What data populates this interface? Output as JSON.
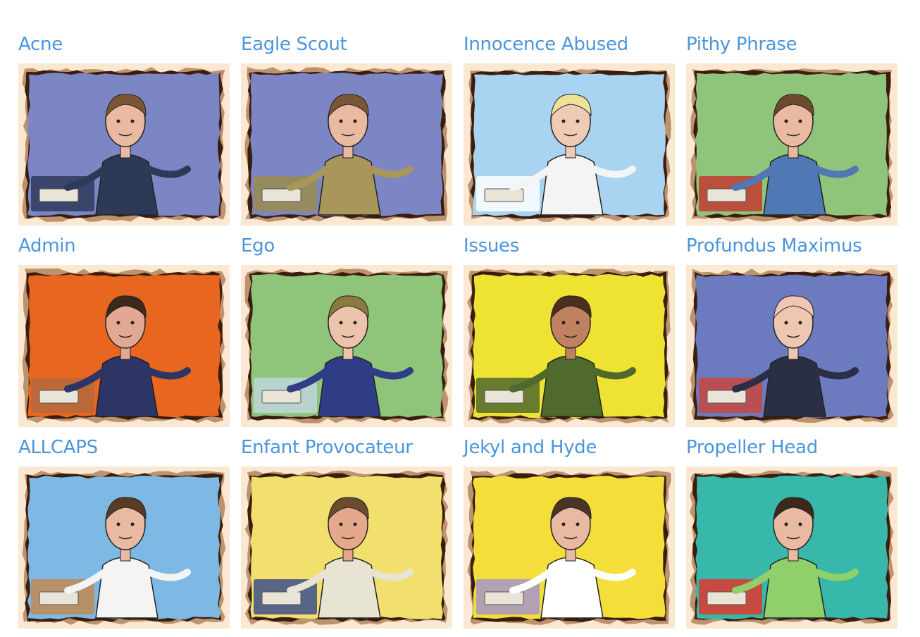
{
  "cards": [
    {
      "title": "Acne",
      "bg": "#7d86c5",
      "accent": "#2f3a5c",
      "shirt": "#2c3a57",
      "skin": "#e9b9a1",
      "hair": "#7a5635"
    },
    {
      "title": "Eagle Scout",
      "bg": "#7d86c5",
      "accent": "#9a8b4e",
      "shirt": "#a8965a",
      "skin": "#e9b9a1",
      "hair": "#7a5635"
    },
    {
      "title": "Innocence Abused",
      "bg": "#a9d4f1",
      "accent": "#ffffff",
      "shirt": "#f4f4f4",
      "skin": "#efcbb6",
      "hair": "#efe09a"
    },
    {
      "title": "Pithy Phrase",
      "bg": "#8fc57a",
      "accent": "#c23a33",
      "shirt": "#4f78b4",
      "skin": "#e9b9a1",
      "hair": "#6b4a2d"
    },
    {
      "title": "Admin",
      "bg": "#e8661f",
      "accent": "#b5683d",
      "shirt": "#2c3566",
      "skin": "#e2a893",
      "hair": "#3b2a1c"
    },
    {
      "title": "Ego",
      "bg": "#8fc57a",
      "accent": "#bfd3dc",
      "shirt": "#2f3d86",
      "skin": "#edc3ac",
      "hair": "#8a7a3e"
    },
    {
      "title": "Issues",
      "bg": "#eee332",
      "accent": "#4f6a2c",
      "shirt": "#4f6a2c",
      "skin": "#c08160",
      "hair": "#4a2f1e"
    },
    {
      "title": "Profundus Maximus",
      "bg": "#6c7bc0",
      "accent": "#c7483f",
      "shirt": "#2a2f45",
      "skin": "#efc6b2",
      "hair": "#efc6b2"
    },
    {
      "title": "ALLCAPS",
      "bg": "#7db9e4",
      "accent": "#c08a52",
      "shirt": "#f4f4f4",
      "skin": "#e9b9a1",
      "hair": "#5a3a25"
    },
    {
      "title": "Enfant Provocateur",
      "bg": "#f1e06e",
      "accent": "#3e4f8c",
      "shirt": "#e8e4d4",
      "skin": "#e5a88c",
      "hair": "#6b4a2d"
    },
    {
      "title": "Jekyl and Hyde",
      "bg": "#f3de3a",
      "accent": "#a596c8",
      "shirt": "#ffffff",
      "skin": "#e9b9a1",
      "hair": "#4a3424"
    },
    {
      "title": "Propeller Head",
      "bg": "#38b8ab",
      "accent": "#e0362d",
      "shirt": "#8fd06a",
      "skin": "#e9b9a1",
      "hair": "#3b2a1c"
    }
  ]
}
